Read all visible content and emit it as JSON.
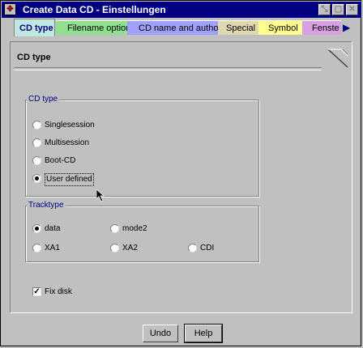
{
  "window": {
    "title": "Create Data CD - Einstellungen"
  },
  "tabs": [
    {
      "label": "CD type",
      "color": "#c0e8e0",
      "active": true
    },
    {
      "label": "Filename options",
      "color": "#8fe08f"
    },
    {
      "label": "CD name and author",
      "color": "#a0a0ff"
    },
    {
      "label": "Special",
      "color": "#e0d8b0"
    },
    {
      "label": "Symbol",
      "color": "#ffff90"
    },
    {
      "label": "Fenste",
      "color": "#d8a0e0"
    }
  ],
  "page": {
    "header": "CD type"
  },
  "cdtype": {
    "legend": "CD type",
    "options": [
      {
        "label": "Singlesession",
        "selected": false
      },
      {
        "label": "Multisession",
        "selected": false
      },
      {
        "label": "Boot-CD",
        "selected": false
      },
      {
        "label": "User defined",
        "selected": true
      }
    ]
  },
  "tracktype": {
    "legend": "Tracktype",
    "options": [
      {
        "label": "data",
        "selected": true
      },
      {
        "label": "mode2",
        "selected": false
      },
      {
        "label": "XA1",
        "selected": false
      },
      {
        "label": "XA2",
        "selected": false
      },
      {
        "label": "CDI",
        "selected": false
      }
    ]
  },
  "fixdisk": {
    "label": "Fix disk",
    "checked": true
  },
  "buttons": {
    "undo": "Undo",
    "help": "Help"
  },
  "colors": {
    "titlebar": "#000080",
    "face": "#c0c0c0",
    "accent": "#000080"
  }
}
